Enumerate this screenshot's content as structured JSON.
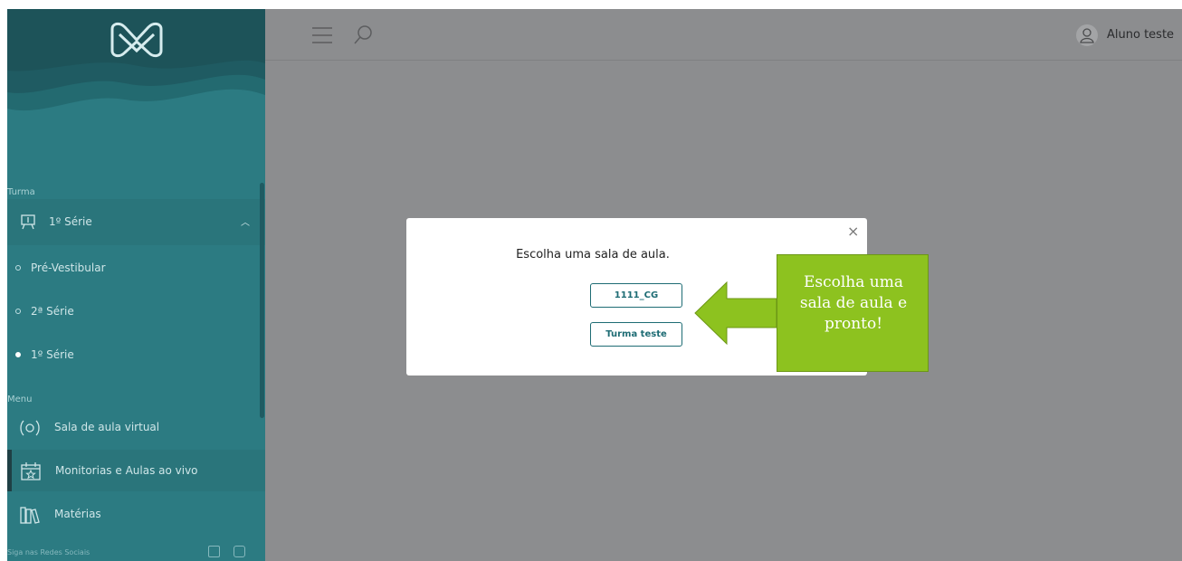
{
  "sidebar": {
    "turma_label": "Turma",
    "current_class": "1º Série",
    "class_options": [
      {
        "label": "Pré-Vestibular",
        "selected": false
      },
      {
        "label": "2ª Série",
        "selected": false
      },
      {
        "label": "1º Série",
        "selected": true
      }
    ],
    "menu_label": "Menu",
    "menu_items": [
      {
        "label": "Sala de aula virtual",
        "icon": "virtual-classroom-icon"
      },
      {
        "label": "Monitorias e Aulas ao vivo",
        "icon": "calendar-star-icon",
        "active": true
      },
      {
        "label": "Matérias",
        "icon": "books-icon"
      }
    ],
    "social_label": "Siga nas Redes Sociais",
    "colors": {
      "sidebar": "#2c7b82",
      "wave": "#1f5b62"
    }
  },
  "header": {
    "user_name": "Aluno teste"
  },
  "modal": {
    "title": "Escolha uma sala de aula.",
    "rooms": [
      "1111_CG",
      "Turma teste"
    ],
    "close_label": "×"
  },
  "callout": {
    "text": "Escolha uma\nsala de aula e\npronto!",
    "color": "#8dc21f"
  },
  "colors": {
    "overlay": "#8c8d8f",
    "accent": "#1e6c74"
  }
}
